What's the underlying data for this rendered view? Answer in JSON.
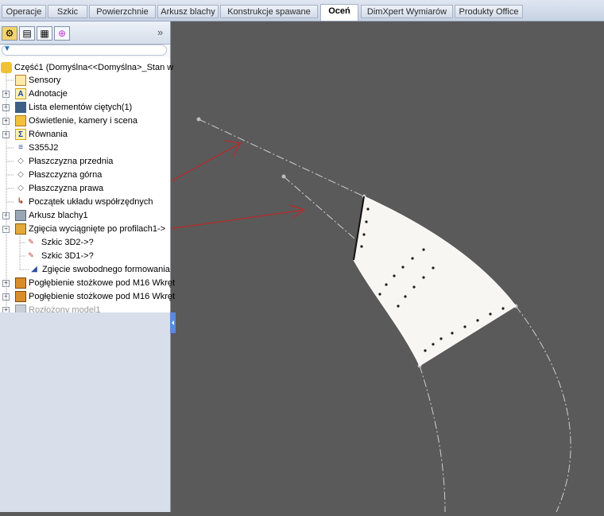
{
  "tabs": [
    "Operacje",
    "Szkic",
    "Powierzchnie",
    "Arkusz blachy",
    "Konstrukcje spawane",
    "Oceń",
    "DimXpert Wymiarów",
    "Produkty Office"
  ],
  "active_tab": "Oceń",
  "panel": {
    "overflow_label": "»",
    "tree": [
      {
        "label": "Część1  (Domyślna<<Domyślna>_Stan w",
        "icon": "part-icon"
      },
      {
        "label": "Sensory",
        "icon": "sensor-icon"
      },
      {
        "label": "Adnotacje",
        "icon": "annotation-icon"
      },
      {
        "label": "Lista elementów ciętych(1)",
        "icon": "cutlist-icon"
      },
      {
        "label": "Oświetlenie, kamery i scena",
        "icon": "lights-icon"
      },
      {
        "label": "Równania",
        "icon": "equations-icon"
      },
      {
        "label": "S355J2",
        "icon": "material-icon"
      },
      {
        "label": "Płaszczyzna przednia",
        "icon": "plane-icon"
      },
      {
        "label": "Płaszczyzna górna",
        "icon": "plane-icon"
      },
      {
        "label": "Płaszczyzna prawa",
        "icon": "plane-icon"
      },
      {
        "label": "Początek układu współrzędnych",
        "icon": "origin-icon"
      },
      {
        "label": "Arkusz blachy1",
        "icon": "sheetmetal-icon"
      },
      {
        "label": "Zgięcia wyciągnięte po profilach1->",
        "icon": "lofted-bend-icon"
      },
      {
        "label": "Szkic 3D2->?",
        "icon": "sketch3d-icon"
      },
      {
        "label": "Szkic 3D1->?",
        "icon": "sketch3d-icon"
      },
      {
        "label": "Zgięcie swobodnego formowania",
        "icon": "flatten-icon"
      },
      {
        "label": "Pogłębienie stożkowe pod M16 Wkręt",
        "icon": "hole-icon"
      },
      {
        "label": "Pogłębienie stożkowe pod M16 Wkręt",
        "icon": "hole-icon"
      },
      {
        "label": "Rozłożony model1",
        "icon": "flat-pattern-icon"
      }
    ]
  }
}
